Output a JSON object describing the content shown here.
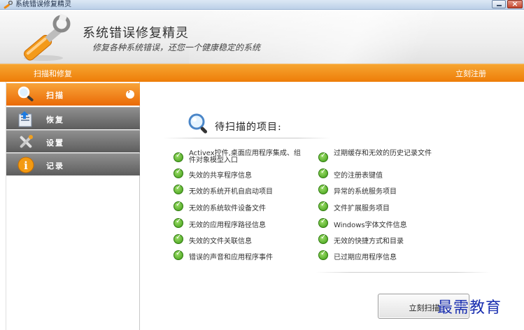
{
  "window": {
    "title": "系统错误修复精灵"
  },
  "header": {
    "app_name": "系统错误修复精灵",
    "slogan": "修复各种系统错误，还您一个健康稳定的系统"
  },
  "bar": {
    "section": "扫描和修复",
    "register": "立刻注册"
  },
  "sidebar": {
    "items": [
      {
        "label": "扫描",
        "icon": "magnifier-icon",
        "active": true
      },
      {
        "label": "恢复",
        "icon": "restore-icon",
        "active": false
      },
      {
        "label": "设置",
        "icon": "tools-icon",
        "active": false
      },
      {
        "label": "记录",
        "icon": "info-icon",
        "active": false
      }
    ]
  },
  "main": {
    "pending_title": "待扫描的项目:",
    "left_items": [
      "Activex控件,桌面应用程序集成、组件对象模型入口",
      "失效的共享程序信息",
      "无效的系统开机自启动项目",
      "无效的系统软件设备文件",
      "无效的应用程序路径信息",
      "失效的文件关联信息",
      "错误的声音和应用程序事件"
    ],
    "right_items": [
      "过期缓存和无效的历史记录文件",
      "空的注册表键值",
      "异常的系统服务项目",
      "文件扩展服务项目",
      "Windows字体文件信息",
      "无效的快捷方式和目录",
      "已过期应用程序信息"
    ],
    "scan_button": "立刻扫描"
  },
  "watermark": "最需教育",
  "colors": {
    "accent": "#ee7d08",
    "nav_inactive": "#6f6f6f",
    "check": "#3c9a14"
  }
}
